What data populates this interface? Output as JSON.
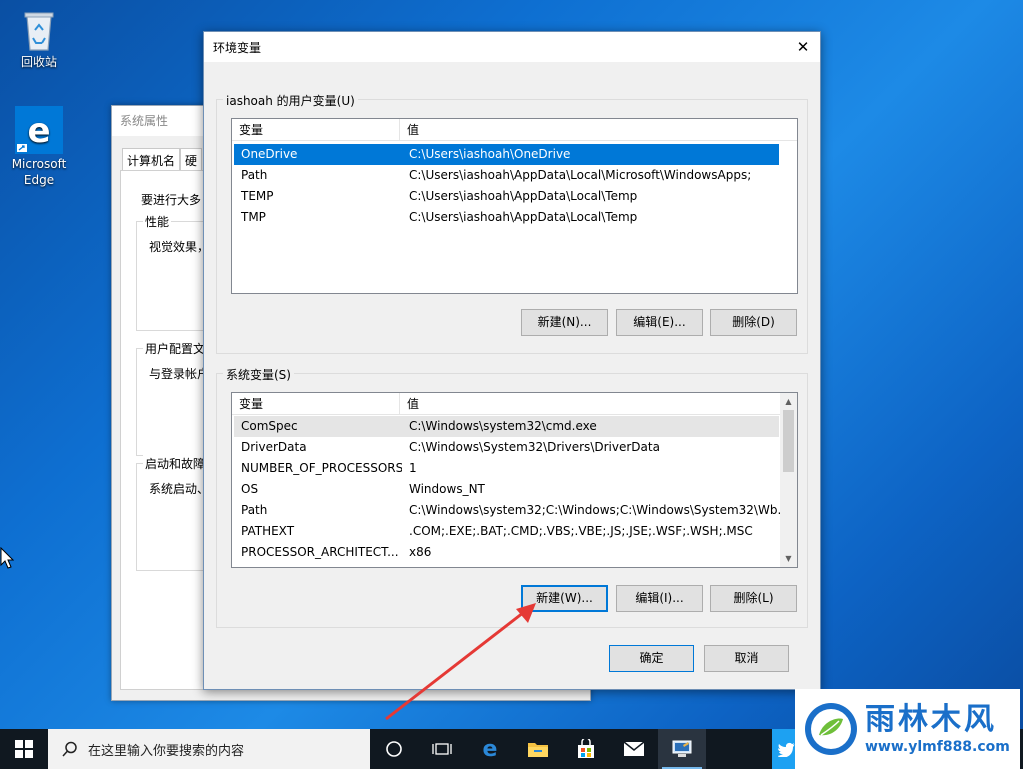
{
  "desktop": {
    "icons": [
      {
        "label": "回收站",
        "icon": "recycle-bin-icon"
      },
      {
        "label": "Microsoft Edge",
        "icon": "edge-icon"
      }
    ]
  },
  "system_properties": {
    "title": "系统属性",
    "tabs": [
      "计算机名",
      "硬"
    ],
    "intro": "要进行大多",
    "groups": [
      {
        "title": "性能",
        "text": "视觉效果，"
      },
      {
        "title": "用户配置文",
        "text": "与登录帐户"
      },
      {
        "title": "启动和故障",
        "text": "系统启动、"
      }
    ]
  },
  "env_dialog": {
    "title": "环境变量",
    "user_section": {
      "legend": "iashoah 的用户变量(U)",
      "columns": [
        "变量",
        "值"
      ],
      "rows": [
        {
          "name": "OneDrive",
          "value": "C:\\Users\\iashoah\\OneDrive",
          "selected": true
        },
        {
          "name": "Path",
          "value": "C:\\Users\\iashoah\\AppData\\Local\\Microsoft\\WindowsApps;"
        },
        {
          "name": "TEMP",
          "value": "C:\\Users\\iashoah\\AppData\\Local\\Temp"
        },
        {
          "name": "TMP",
          "value": "C:\\Users\\iashoah\\AppData\\Local\\Temp"
        }
      ],
      "buttons": {
        "new": "新建(N)...",
        "edit": "编辑(E)...",
        "delete": "删除(D)"
      }
    },
    "system_section": {
      "legend": "系统变量(S)",
      "columns": [
        "变量",
        "值"
      ],
      "rows": [
        {
          "name": "ComSpec",
          "value": "C:\\Windows\\system32\\cmd.exe"
        },
        {
          "name": "DriverData",
          "value": "C:\\Windows\\System32\\Drivers\\DriverData"
        },
        {
          "name": "NUMBER_OF_PROCESSORS",
          "value": "1"
        },
        {
          "name": "OS",
          "value": "Windows_NT"
        },
        {
          "name": "Path",
          "value": "C:\\Windows\\system32;C:\\Windows;C:\\Windows\\System32\\Wb..."
        },
        {
          "name": "PATHEXT",
          "value": ".COM;.EXE;.BAT;.CMD;.VBS;.VBE;.JS;.JSE;.WSF;.WSH;.MSC"
        },
        {
          "name": "PROCESSOR_ARCHITECT...",
          "value": "x86"
        }
      ],
      "buttons": {
        "new": "新建(W)...",
        "edit": "编辑(I)...",
        "delete": "删除(L)"
      }
    },
    "ok": "确定",
    "cancel": "取消"
  },
  "taskbar": {
    "search_placeholder": "在这里输入你要搜索的内容",
    "apps": [
      "task-view-icon",
      "edge-icon",
      "file-explorer-icon",
      "store-icon",
      "mail-icon",
      "system-properties-icon"
    ]
  },
  "watermark": {
    "title": "雨林木风",
    "url": "www.ylmf888.com"
  },
  "colors": {
    "selection": "#0078d7",
    "annotation_arrow": "#e53935",
    "watermark_blue": "#1a6fc9"
  }
}
